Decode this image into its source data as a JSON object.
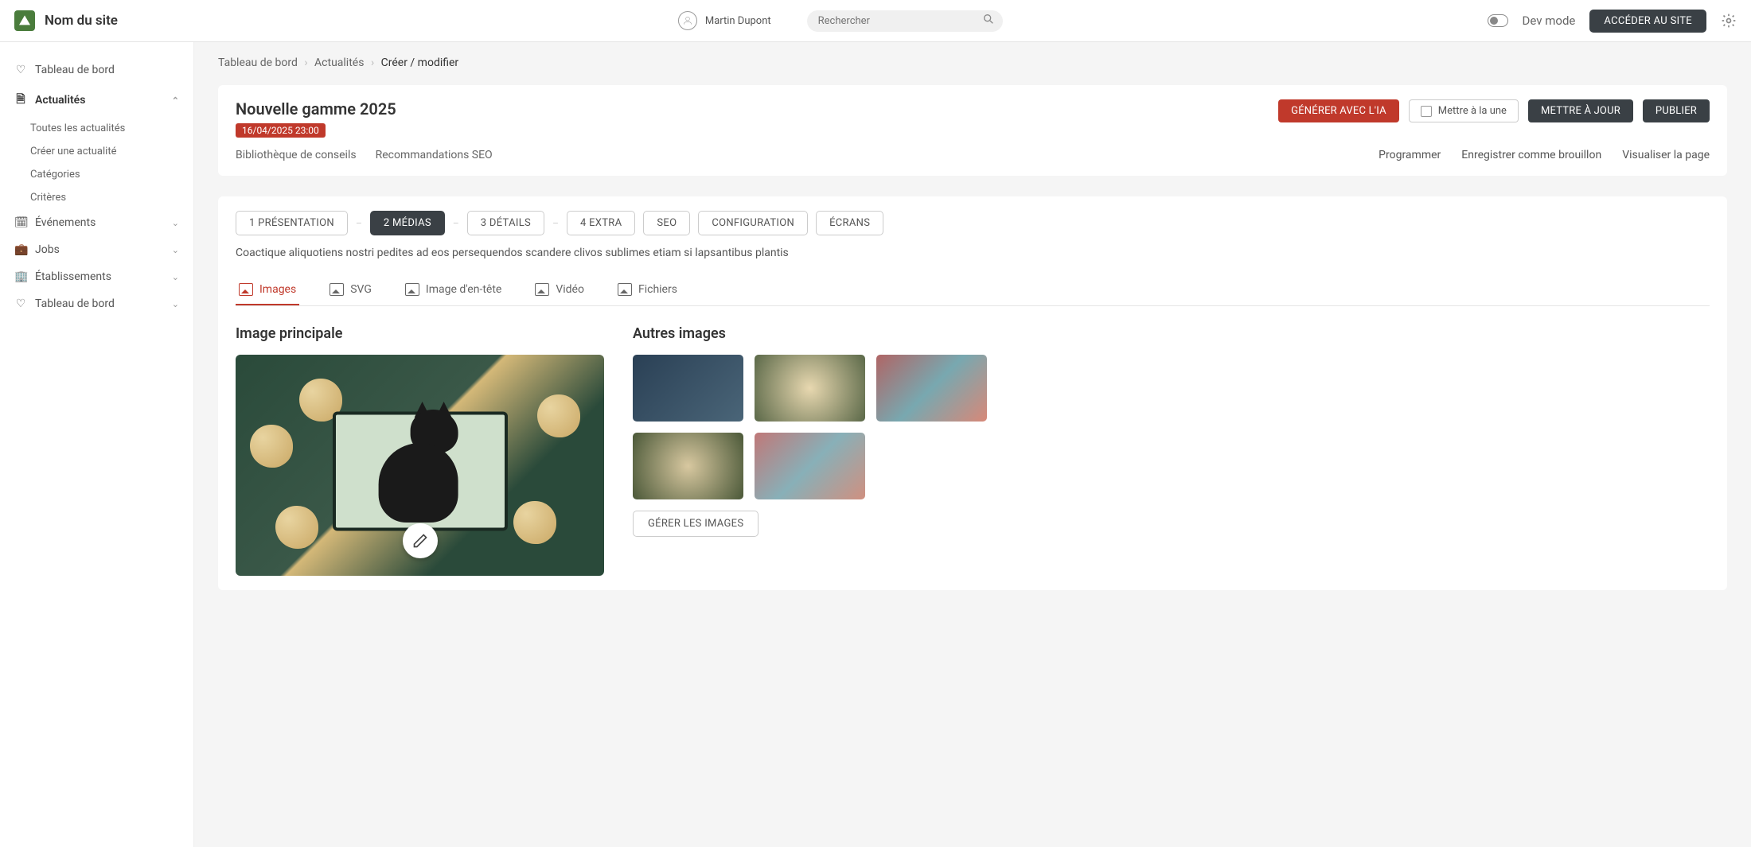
{
  "header": {
    "site_name": "Nom du site",
    "user_name": "Martin Dupont",
    "search_placeholder": "Rechercher",
    "dev_mode_label": "Dev mode",
    "access_site_label": "ACCÉDER AU SITE"
  },
  "sidebar": {
    "items": [
      {
        "label": "Tableau de bord",
        "icon": "heart"
      },
      {
        "label": "Actualités",
        "icon": "doc",
        "open": true,
        "children": [
          {
            "label": "Toutes les actualités"
          },
          {
            "label": "Créer une actualité"
          },
          {
            "label": "Catégories"
          },
          {
            "label": "Critères"
          }
        ]
      },
      {
        "label": "Événements",
        "icon": "calendar"
      },
      {
        "label": "Jobs",
        "icon": "briefcase"
      },
      {
        "label": "Établissements",
        "icon": "building"
      },
      {
        "label": "Tableau de bord",
        "icon": "heart"
      }
    ]
  },
  "breadcrumbs": {
    "items": [
      "Tableau de bord",
      "Actualités",
      "Créer / modifier"
    ]
  },
  "edit_panel": {
    "title": "Nouvelle gamme 2025",
    "date": "16/04/2025 23:00",
    "generate_ai_label": "GÉNÉRER AVEC L'IA",
    "featured_label": "Mettre à la une",
    "update_label": "METTRE À JOUR",
    "publish_label": "PUBLIER",
    "library_tab": "Bibliothèque de conseils",
    "seo_tab": "Recommandations SEO",
    "schedule_link": "Programmer",
    "draft_link": "Enregistrer comme brouillon",
    "preview_link": "Visualiser la page"
  },
  "steps": {
    "items": [
      {
        "label": "1 PRÉSENTATION"
      },
      {
        "label": "2 MÉDIAS",
        "active": true
      },
      {
        "label": "3 DÉTAILS"
      },
      {
        "label": "4 EXTRA"
      },
      {
        "label": "SEO"
      },
      {
        "label": "CONFIGURATION"
      },
      {
        "label": "ÉCRANS"
      }
    ]
  },
  "description": "Coactique aliquotiens nostri pedites ad eos persequendos scandere clivos sublimes etiam si lapsantibus plantis",
  "media_tabs": {
    "items": [
      {
        "label": "Images",
        "active": true
      },
      {
        "label": "SVG"
      },
      {
        "label": "Image d'en-tête"
      },
      {
        "label": "Vidéo"
      },
      {
        "label": "Fichiers"
      }
    ]
  },
  "media": {
    "main_title": "Image principale",
    "other_title": "Autres images",
    "manage_label": "GÉRER LES IMAGES"
  },
  "colors": {
    "accent_red": "#c0392b",
    "accent_dark": "#3a4045",
    "brand_green": "#4a7c3c"
  }
}
